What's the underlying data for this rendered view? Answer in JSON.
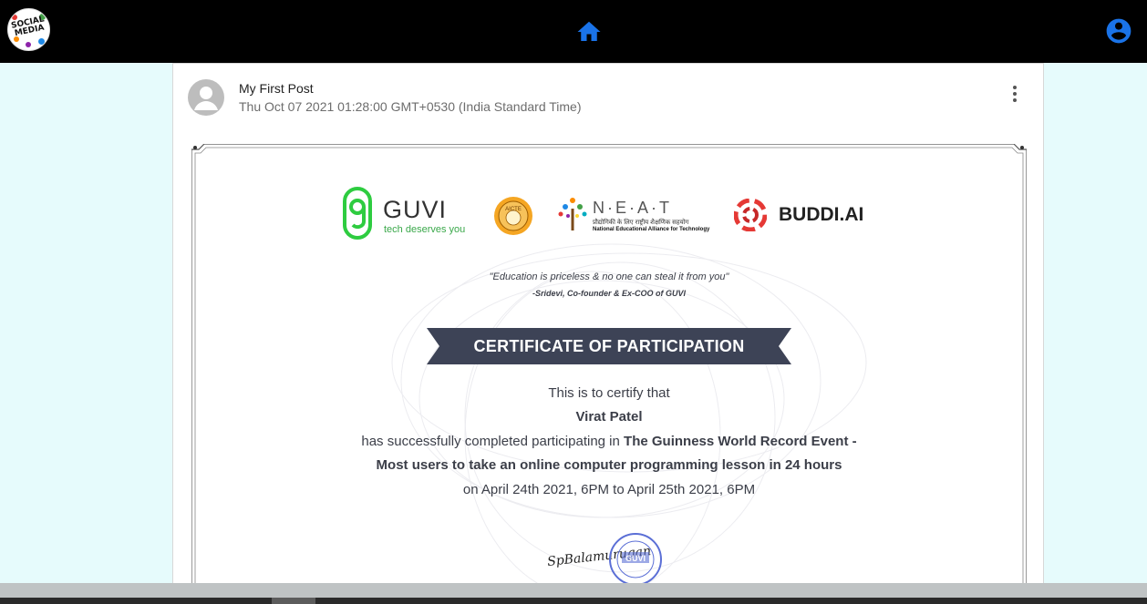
{
  "header": {
    "logo_text_line1": "SOCIAL",
    "logo_text_line2": "MEDIA",
    "home_icon": "home-icon",
    "account_icon": "account-circle-icon",
    "accent_color": "#1a73e8"
  },
  "post": {
    "title": "My First Post",
    "date": "Thu Oct 07 2021 01:28:00 GMT+0530 (India Standard Time)",
    "avatar_icon": "person-icon",
    "menu_icon": "more-vert-icon"
  },
  "certificate": {
    "logos": {
      "guvi_name": "GUVI",
      "guvi_tagline": "tech deserves you",
      "aicte_label": "AICTE",
      "neat_name": "N·E·A·T",
      "neat_hindi": "प्रौद्योगिकी के लिए राष्ट्रीय शैक्षणिक सहयोग",
      "neat_subtitle": "National Educational Alliance for Technology",
      "buddi_name": "BUDDI.AI"
    },
    "quote": "\"Education is priceless & no one can steal it from you\"",
    "quote_author": "-Sridevi, Co-founder & Ex-COO of GUVI",
    "banner": "CERTIFICATE OF PARTICIPATION",
    "line1": "This is to certify that",
    "recipient": "Virat Patel",
    "line3_prefix": "has successfully completed participating in ",
    "line3_event": "The Guinness World Record Event -",
    "line4_event": "Most users to take an online computer programming lesson in 24 hours",
    "line5": "on April 24th 2021, 6PM to April 25th 2021, 6PM",
    "signature": "SpBalamurugan",
    "seal_text": "GUVI"
  }
}
